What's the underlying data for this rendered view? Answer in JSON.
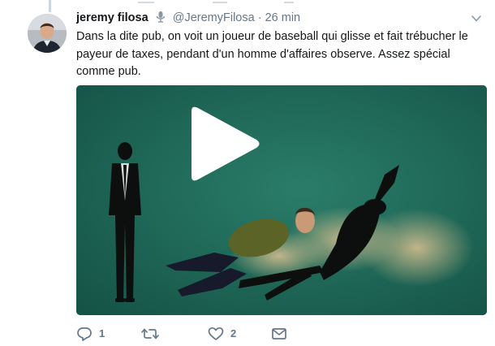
{
  "tweet": {
    "author_name": "jeremy filosa",
    "handle": "@JeremyFilosa",
    "separator": "·",
    "time": "26 min",
    "text": "Dans la dite pub, on voit un joueur de baseball qui glisse et fait trébucher le payeur de taxes, pendant d'un homme d'affaires observe. Assez spécial comme pub.",
    "icons": {
      "mic": "microphone-icon",
      "caret": "chevron-down-icon",
      "play": "play-icon",
      "reply": "reply-icon",
      "retweet": "retweet-icon",
      "like": "heart-icon",
      "dm": "envelope-icon"
    },
    "actions": {
      "reply_count": "1",
      "retweet_count": "",
      "like_count": "2"
    }
  },
  "colors": {
    "accent": "#1da1f2",
    "muted": "#657786",
    "video_background": "#1f6b5a"
  }
}
